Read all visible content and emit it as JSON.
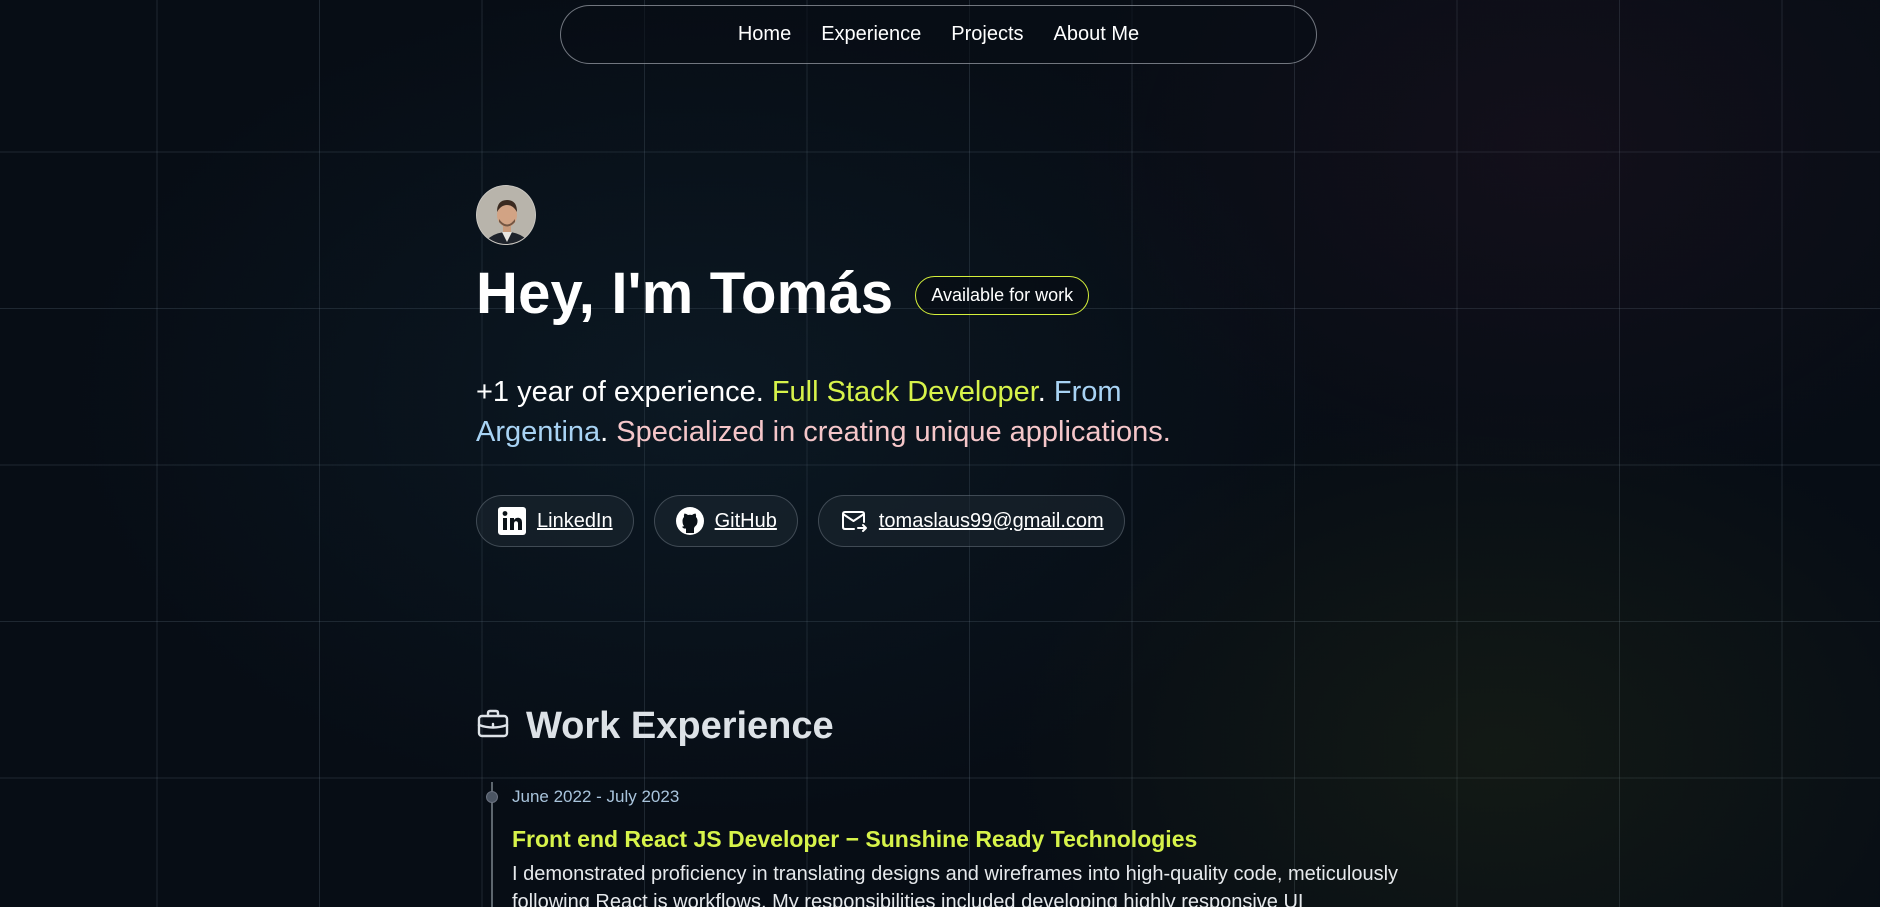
{
  "nav": {
    "items": [
      "Home",
      "Experience",
      "Projects",
      "About Me"
    ]
  },
  "hero": {
    "title": "Hey, I'm Tomás",
    "badge": "Available for work",
    "intro": {
      "part1": "+1 year of experience. ",
      "role": "Full Stack Developer",
      "dot1": ". ",
      "origin": "From Argentina",
      "dot2": ". ",
      "specialty": "Specialized in creating unique applications."
    },
    "colors": {
      "lime": "#d7f34a",
      "blue": "#a8d3f4",
      "pink": "#f5c6c9"
    }
  },
  "socials": {
    "linkedin": {
      "label": "LinkedIn",
      "icon": "linkedin-icon"
    },
    "github": {
      "label": "GitHub",
      "icon": "github-icon"
    },
    "email": {
      "label": "tomaslaus99@gmail.com",
      "icon": "mail-icon"
    }
  },
  "work": {
    "heading": "Work Experience",
    "icon": "briefcase-icon",
    "jobs": [
      {
        "date": "June 2022 - July 2023",
        "title": "Front end React JS Developer − Sunshine Ready Technologies",
        "description": "I demonstrated proficiency in translating designs and wireframes into high-quality code, meticulously following React js workflows. My responsibilities included developing highly responsive UI"
      }
    ]
  }
}
